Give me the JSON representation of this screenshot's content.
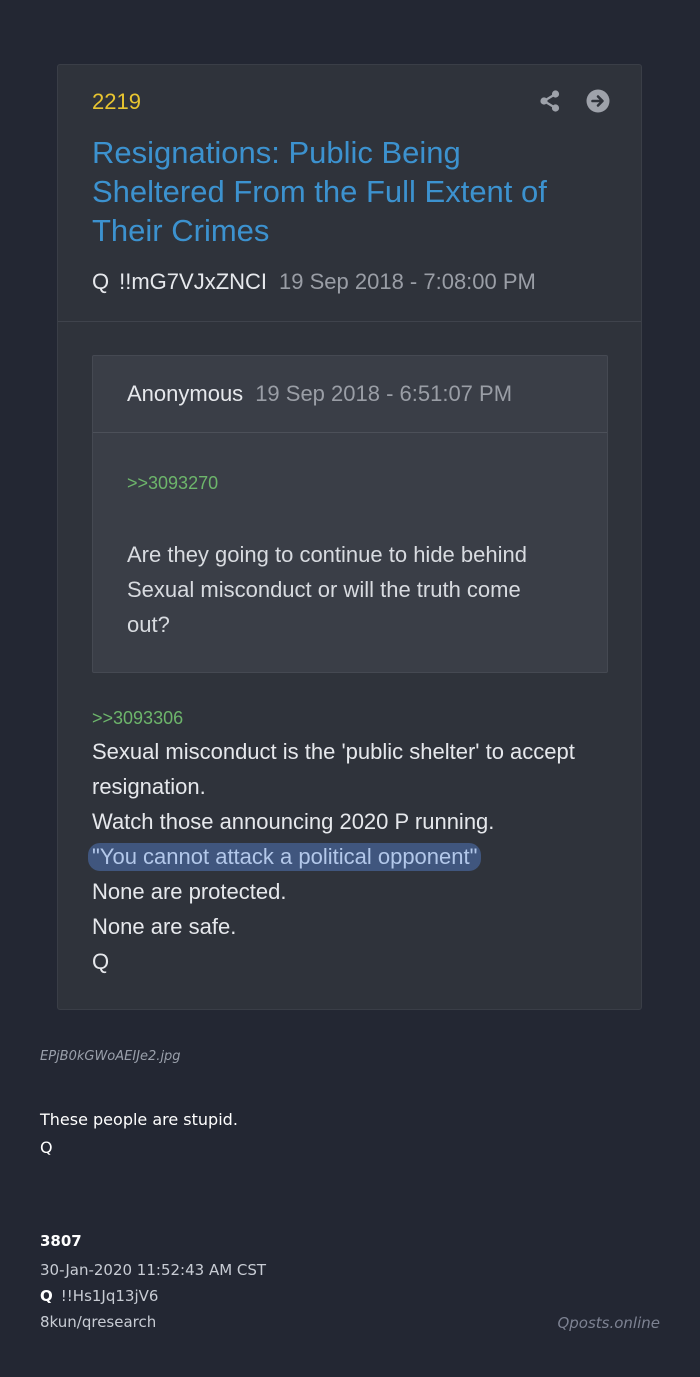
{
  "post": {
    "number": "2219",
    "title": "Resignations: Public Being Sheltered From the Full Extent of Their Crimes",
    "author": "Q",
    "tripcode": "!!mG7VJxZNCI",
    "date": "19 Sep 2018 - 7:08:00 PM"
  },
  "quoted": {
    "author": "Anonymous",
    "date": "19 Sep 2018 - 6:51:07 PM",
    "ref": ">>3093270",
    "text": "Are they going to continue to hide behind Sexual misconduct or will the truth come out?"
  },
  "reply": {
    "ref": ">>3093306",
    "lines": [
      "Sexual misconduct is the 'public shelter' to accept",
      "resignation.",
      "Watch those announcing 2020 P running.",
      "\"You cannot attack a political opponent\"",
      "None are protected.",
      "None are safe.",
      "Q"
    ]
  },
  "attachment": {
    "filename": "EPjB0kGWoAEIJe2.jpg"
  },
  "message": {
    "lines": [
      "These people are stupid.",
      "Q"
    ]
  },
  "footer": {
    "number": "3807",
    "date": "30-Jan-2020 11:52:43 AM CST",
    "author": "Q",
    "tripcode": "!!Hs1Jq13jV6",
    "board": "8kun/qresearch",
    "site": "Qposts.online"
  },
  "colors": {
    "background": "#232733",
    "card": "#2f333b",
    "post_number": "#e8c530",
    "title_link": "#3c92cf",
    "reference_link": "#6db56b",
    "highlight": "#40567e"
  },
  "icons": [
    "share-icon",
    "arrow-right-circle-icon"
  ]
}
